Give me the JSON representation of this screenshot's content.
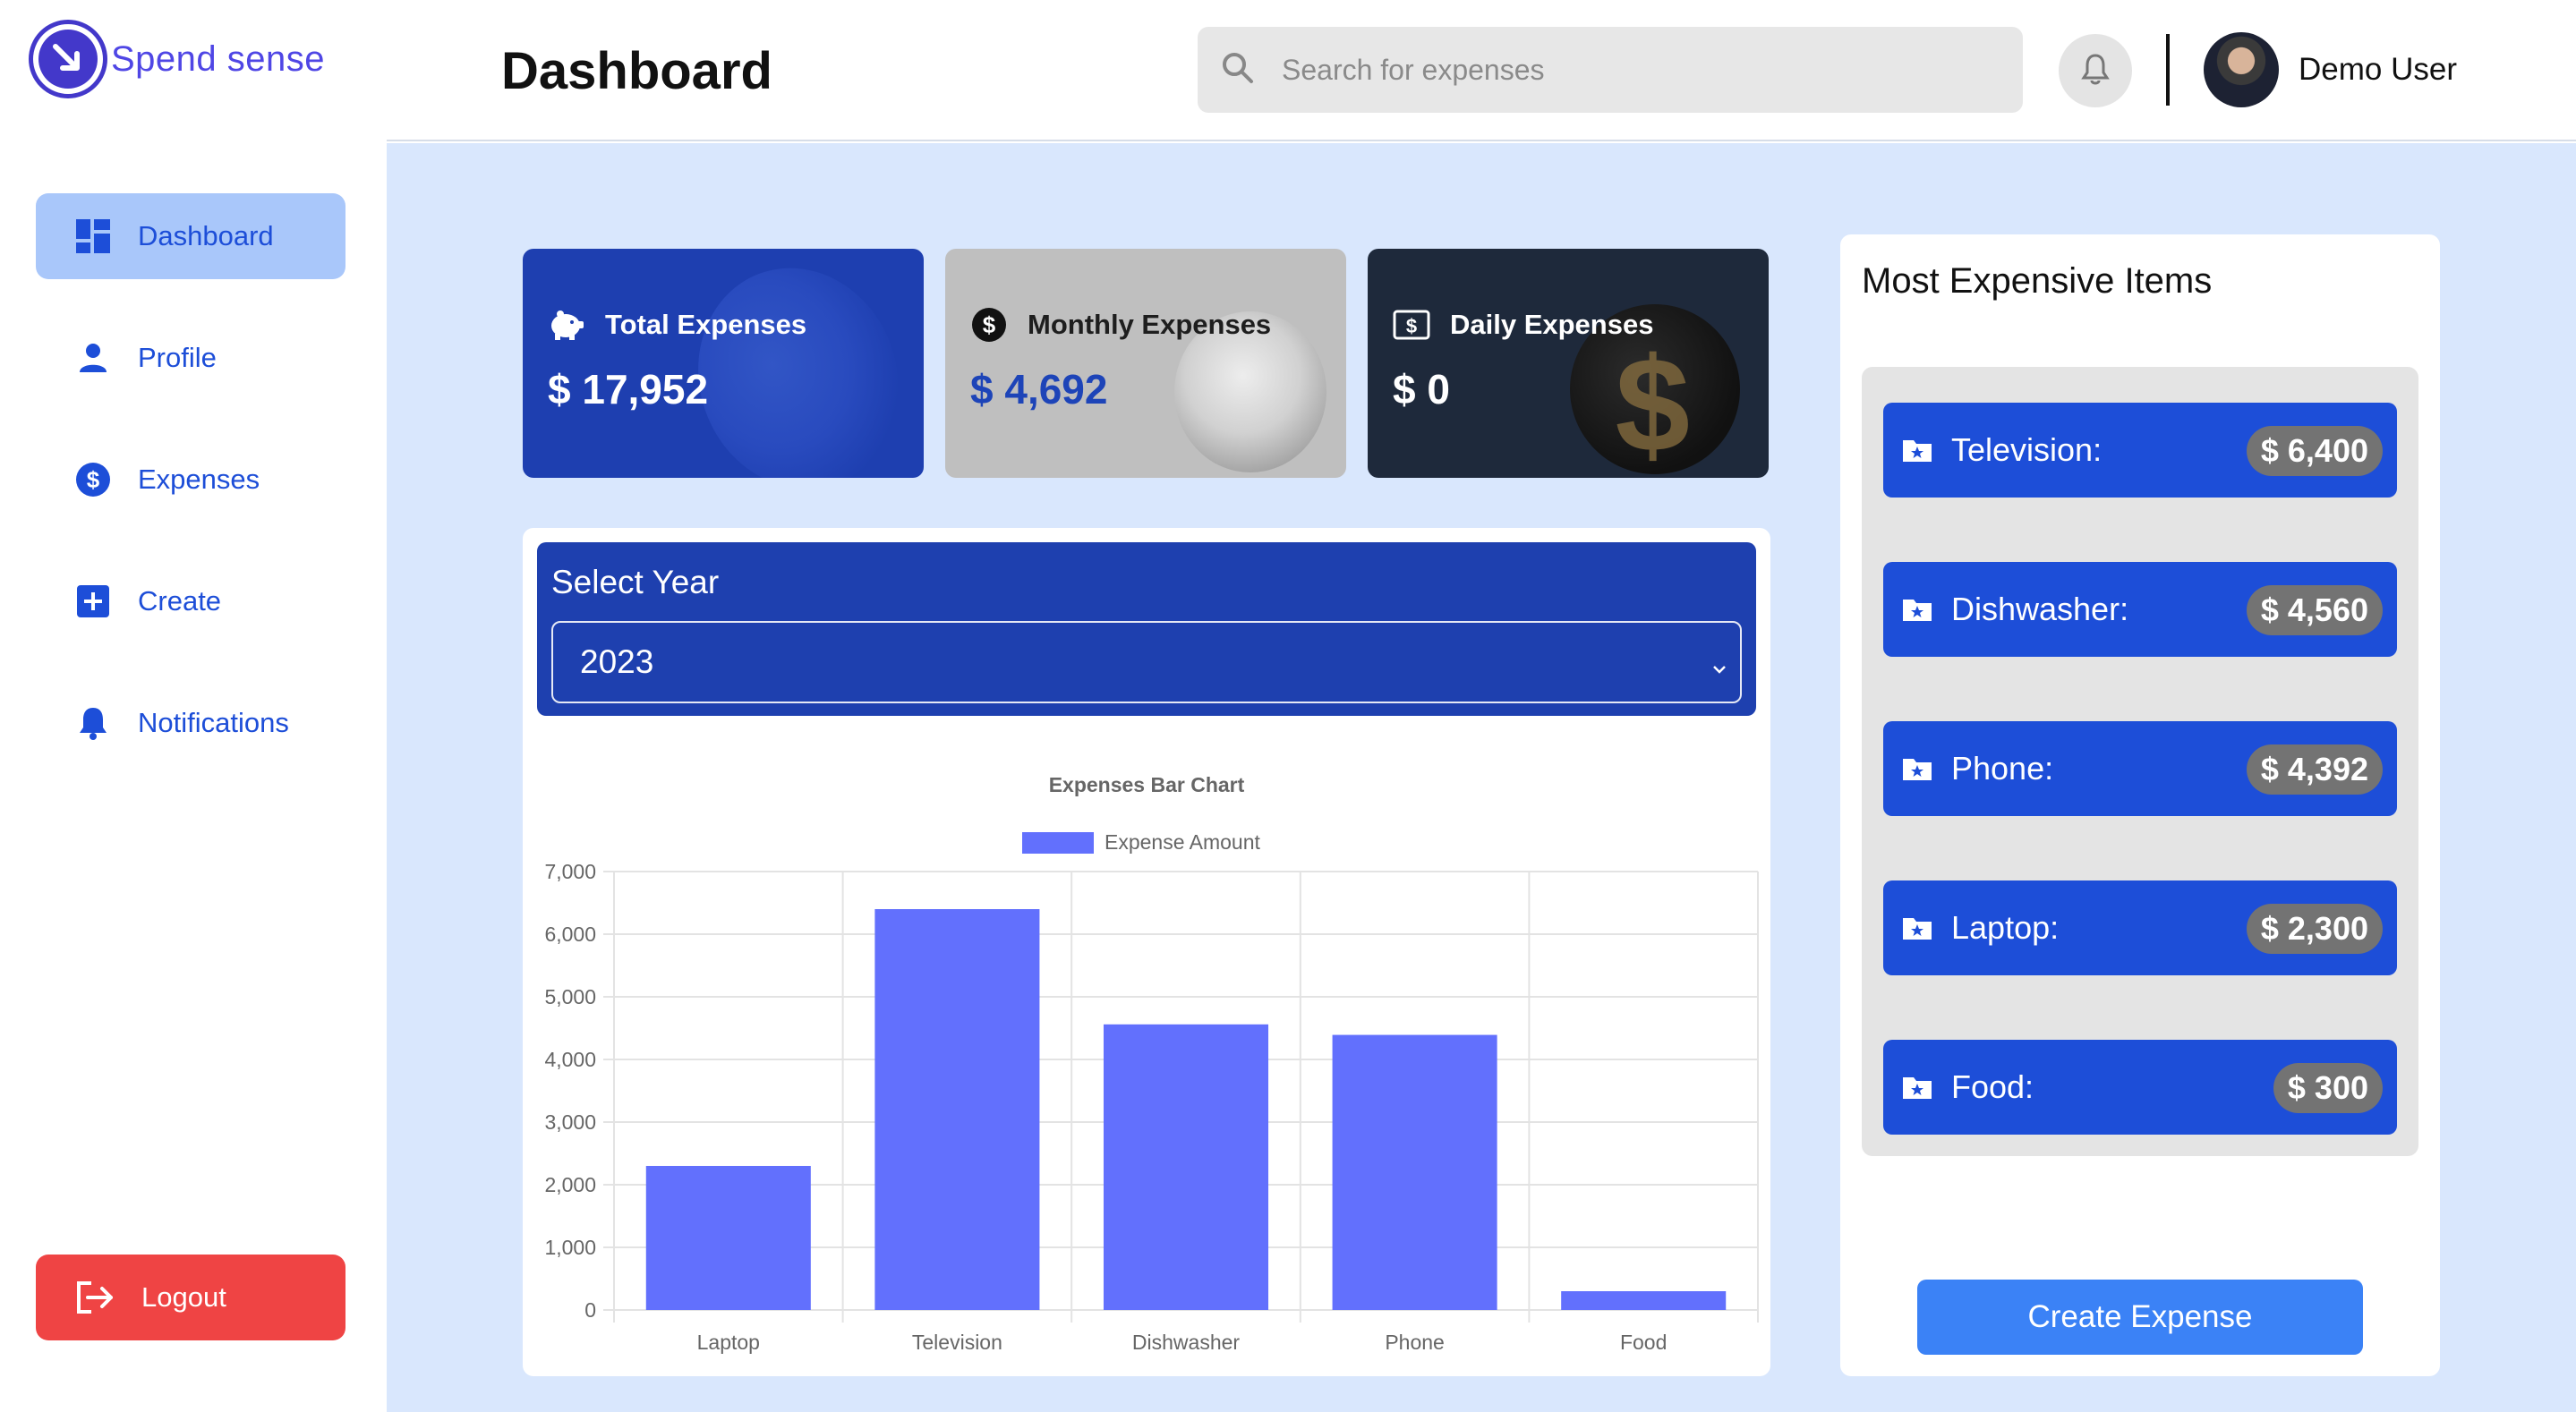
{
  "app": {
    "logo_text": "Spend sense"
  },
  "header": {
    "title": "Dashboard",
    "search_placeholder": "Search for expenses",
    "user_name": "Demo User"
  },
  "sidebar": {
    "items": [
      {
        "label": "Dashboard",
        "icon": "dashboard-grid-icon",
        "active": true
      },
      {
        "label": "Profile",
        "icon": "person-icon",
        "active": false
      },
      {
        "label": "Expenses",
        "icon": "dollar-circle-icon",
        "active": false
      },
      {
        "label": "Create",
        "icon": "plus-square-icon",
        "active": false
      },
      {
        "label": "Notifications",
        "icon": "bell-icon",
        "active": false
      }
    ],
    "logout_label": "Logout"
  },
  "cards": [
    {
      "label": "Total Expenses",
      "value": "$ 17,952",
      "icon": "piggy-bank-icon",
      "color": "#1e3fb0"
    },
    {
      "label": "Monthly Expenses",
      "value": "$ 4,692",
      "icon": "dollar-circle-icon",
      "color": "#bfbfbf"
    },
    {
      "label": "Daily Expenses",
      "value": "$ 0",
      "icon": "money-bill-icon",
      "color": "#1e293b"
    }
  ],
  "year_select": {
    "label": "Select Year",
    "value": "2023"
  },
  "chart_data": {
    "type": "bar",
    "title": "Expenses Bar Chart",
    "categories": [
      "Laptop",
      "Television",
      "Dishwasher",
      "Phone",
      "Food"
    ],
    "series": [
      {
        "name": "Expense Amount",
        "values": [
          2300,
          6400,
          4560,
          4392,
          300
        ]
      }
    ],
    "ylim": [
      0,
      7000
    ],
    "yticks": [
      "0",
      "1,000",
      "2,000",
      "3,000",
      "4,000",
      "5,000",
      "6,000",
      "7,000"
    ],
    "grid": true,
    "legend": "top-center",
    "bar_color": "#6270fd"
  },
  "most_expensive": {
    "title": "Most Expensive Items",
    "items": [
      {
        "name": "Television:",
        "price": "$ 6,400"
      },
      {
        "name": "Dishwasher:",
        "price": "$ 4,560"
      },
      {
        "name": "Phone:",
        "price": "$ 4,392"
      },
      {
        "name": "Laptop:",
        "price": "$ 2,300"
      },
      {
        "name": "Food:",
        "price": "$ 300"
      }
    ],
    "create_label": "Create Expense"
  },
  "colors": {
    "accent": "#1d4ed8",
    "main_bg": "#d9e7fd",
    "logout": "#ef4444",
    "button": "#3b82f6"
  }
}
